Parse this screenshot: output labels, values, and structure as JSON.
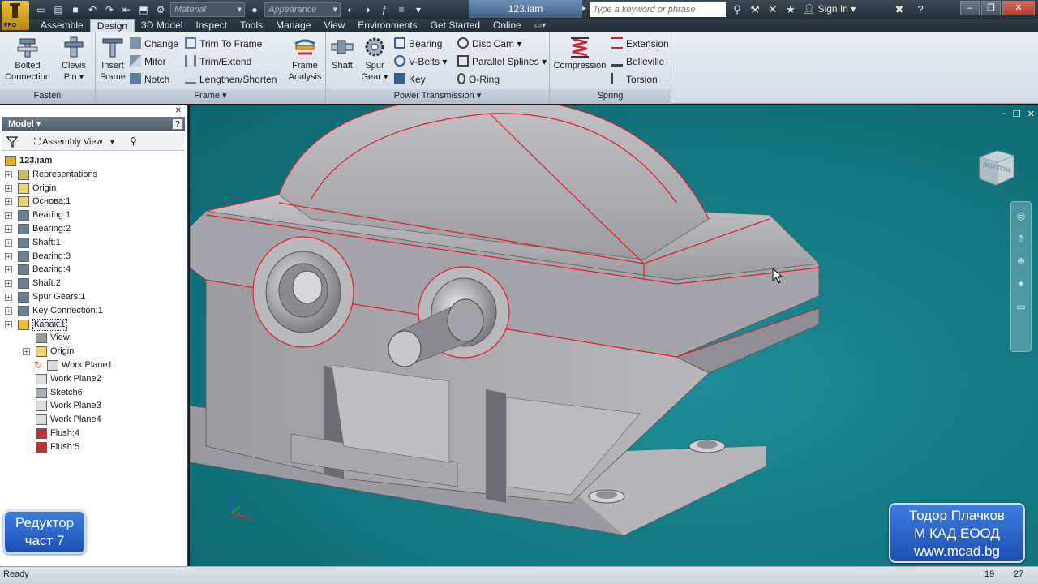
{
  "titlebar": {
    "material_placeholder": "Material",
    "appearance_placeholder": "Appearance",
    "document_title": "123.iam",
    "search_placeholder": "Type a keyword or phrase",
    "signin": "Sign In",
    "logo_badge": "PRO"
  },
  "ribbon_tabs": [
    "Assemble",
    "Design",
    "3D Model",
    "Inspect",
    "Tools",
    "Manage",
    "View",
    "Environments",
    "Get Started",
    "Online"
  ],
  "active_tab": "Design",
  "ribbon": {
    "fasten": {
      "title": "Fasten",
      "bolted_connection_1": "Bolted",
      "bolted_connection_2": "Connection",
      "clevis_pin_1": "Clevis",
      "clevis_pin_2": "Pin"
    },
    "frame": {
      "title": "Frame",
      "insert_frame_1": "Insert",
      "insert_frame_2": "Frame",
      "change": "Change",
      "miter": "Miter",
      "notch": "Notch",
      "trim_to_frame": "Trim To Frame",
      "trim_extend": "Trim/Extend",
      "lengthen_shorten": "Lengthen/Shorten",
      "frame_analysis_1": "Frame",
      "frame_analysis_2": "Analysis"
    },
    "power_transmission": {
      "title": "Power Transmission",
      "shaft": "Shaft",
      "spur_gear_1": "Spur",
      "spur_gear_2": "Gear",
      "bearing": "Bearing",
      "v_belts": "V-Belts",
      "key": "Key",
      "disc_cam": "Disc Cam",
      "parallel_splines": "Parallel Splines",
      "o_ring": "O-Ring"
    },
    "spring": {
      "title": "Spring",
      "compression": "Compression",
      "extension": "Extension",
      "belleville": "Belleville",
      "torsion": "Torsion"
    }
  },
  "browser": {
    "header": "Model",
    "view_select": "Assembly View",
    "help": "?",
    "tree": [
      {
        "label": "123.iam",
        "level": 0,
        "icon": "assembly-icon",
        "expander": false
      },
      {
        "label": "Representations",
        "level": 1,
        "icon": "representations-icon",
        "expander": true
      },
      {
        "label": "Origin",
        "level": 1,
        "icon": "folder-icon",
        "expander": true
      },
      {
        "label": "Основа:1",
        "level": 1,
        "icon": "part-icon",
        "expander": true
      },
      {
        "label": "Bearing:1",
        "level": 1,
        "icon": "bearing-icon",
        "expander": true
      },
      {
        "label": "Bearing:2",
        "level": 1,
        "icon": "bearing-icon",
        "expander": true
      },
      {
        "label": "Shaft:1",
        "level": 1,
        "icon": "shaft-icon",
        "expander": true
      },
      {
        "label": "Bearing:3",
        "level": 1,
        "icon": "bearing-icon",
        "expander": true
      },
      {
        "label": "Bearing:4",
        "level": 1,
        "icon": "bearing-icon",
        "expander": true
      },
      {
        "label": "Shaft:2",
        "level": 1,
        "icon": "shaft-icon",
        "expander": true
      },
      {
        "label": "Spur Gears:1",
        "level": 1,
        "icon": "spur-gears-icon",
        "expander": true
      },
      {
        "label": "Key Connection:1",
        "level": 1,
        "icon": "key-connection-icon",
        "expander": true
      },
      {
        "label": "Капак:1",
        "level": 1,
        "icon": "part-edit-icon",
        "expander": true,
        "selected": true
      },
      {
        "label": "View:",
        "level": 2,
        "icon": "view-icon",
        "expander": false
      },
      {
        "label": "Origin",
        "level": 2,
        "icon": "folder-icon",
        "expander": true
      },
      {
        "label": "Work Plane1",
        "level": 2,
        "icon": "work-plane-icon",
        "expander": false,
        "update": true
      },
      {
        "label": "Work Plane2",
        "level": 2,
        "icon": "work-plane-icon",
        "expander": false
      },
      {
        "label": "Sketch6",
        "level": 2,
        "icon": "sketch-icon",
        "expander": false
      },
      {
        "label": "Work Plane3",
        "level": 2,
        "icon": "work-plane-icon",
        "expander": false
      },
      {
        "label": "Work Plane4",
        "level": 2,
        "icon": "work-plane-icon",
        "expander": false
      },
      {
        "label": "Flush:4",
        "level": 2,
        "icon": "flush-icon",
        "expander": false
      },
      {
        "label": "Flush:5",
        "level": 2,
        "icon": "flush-icon",
        "expander": false
      }
    ]
  },
  "viewport": {
    "viewcube_label": "BOTTOM",
    "overlay_left": [
      "Редуктор",
      "част 7"
    ],
    "overlay_right": [
      "Тодор Плачков",
      "М КАД ЕООД",
      "www.mcad.bg"
    ],
    "background_color": "#147a84",
    "model_color": "#a9a9ad",
    "edge_color": "#e0202a"
  },
  "status": {
    "text": "Ready",
    "num1": "19",
    "num2": "27"
  }
}
